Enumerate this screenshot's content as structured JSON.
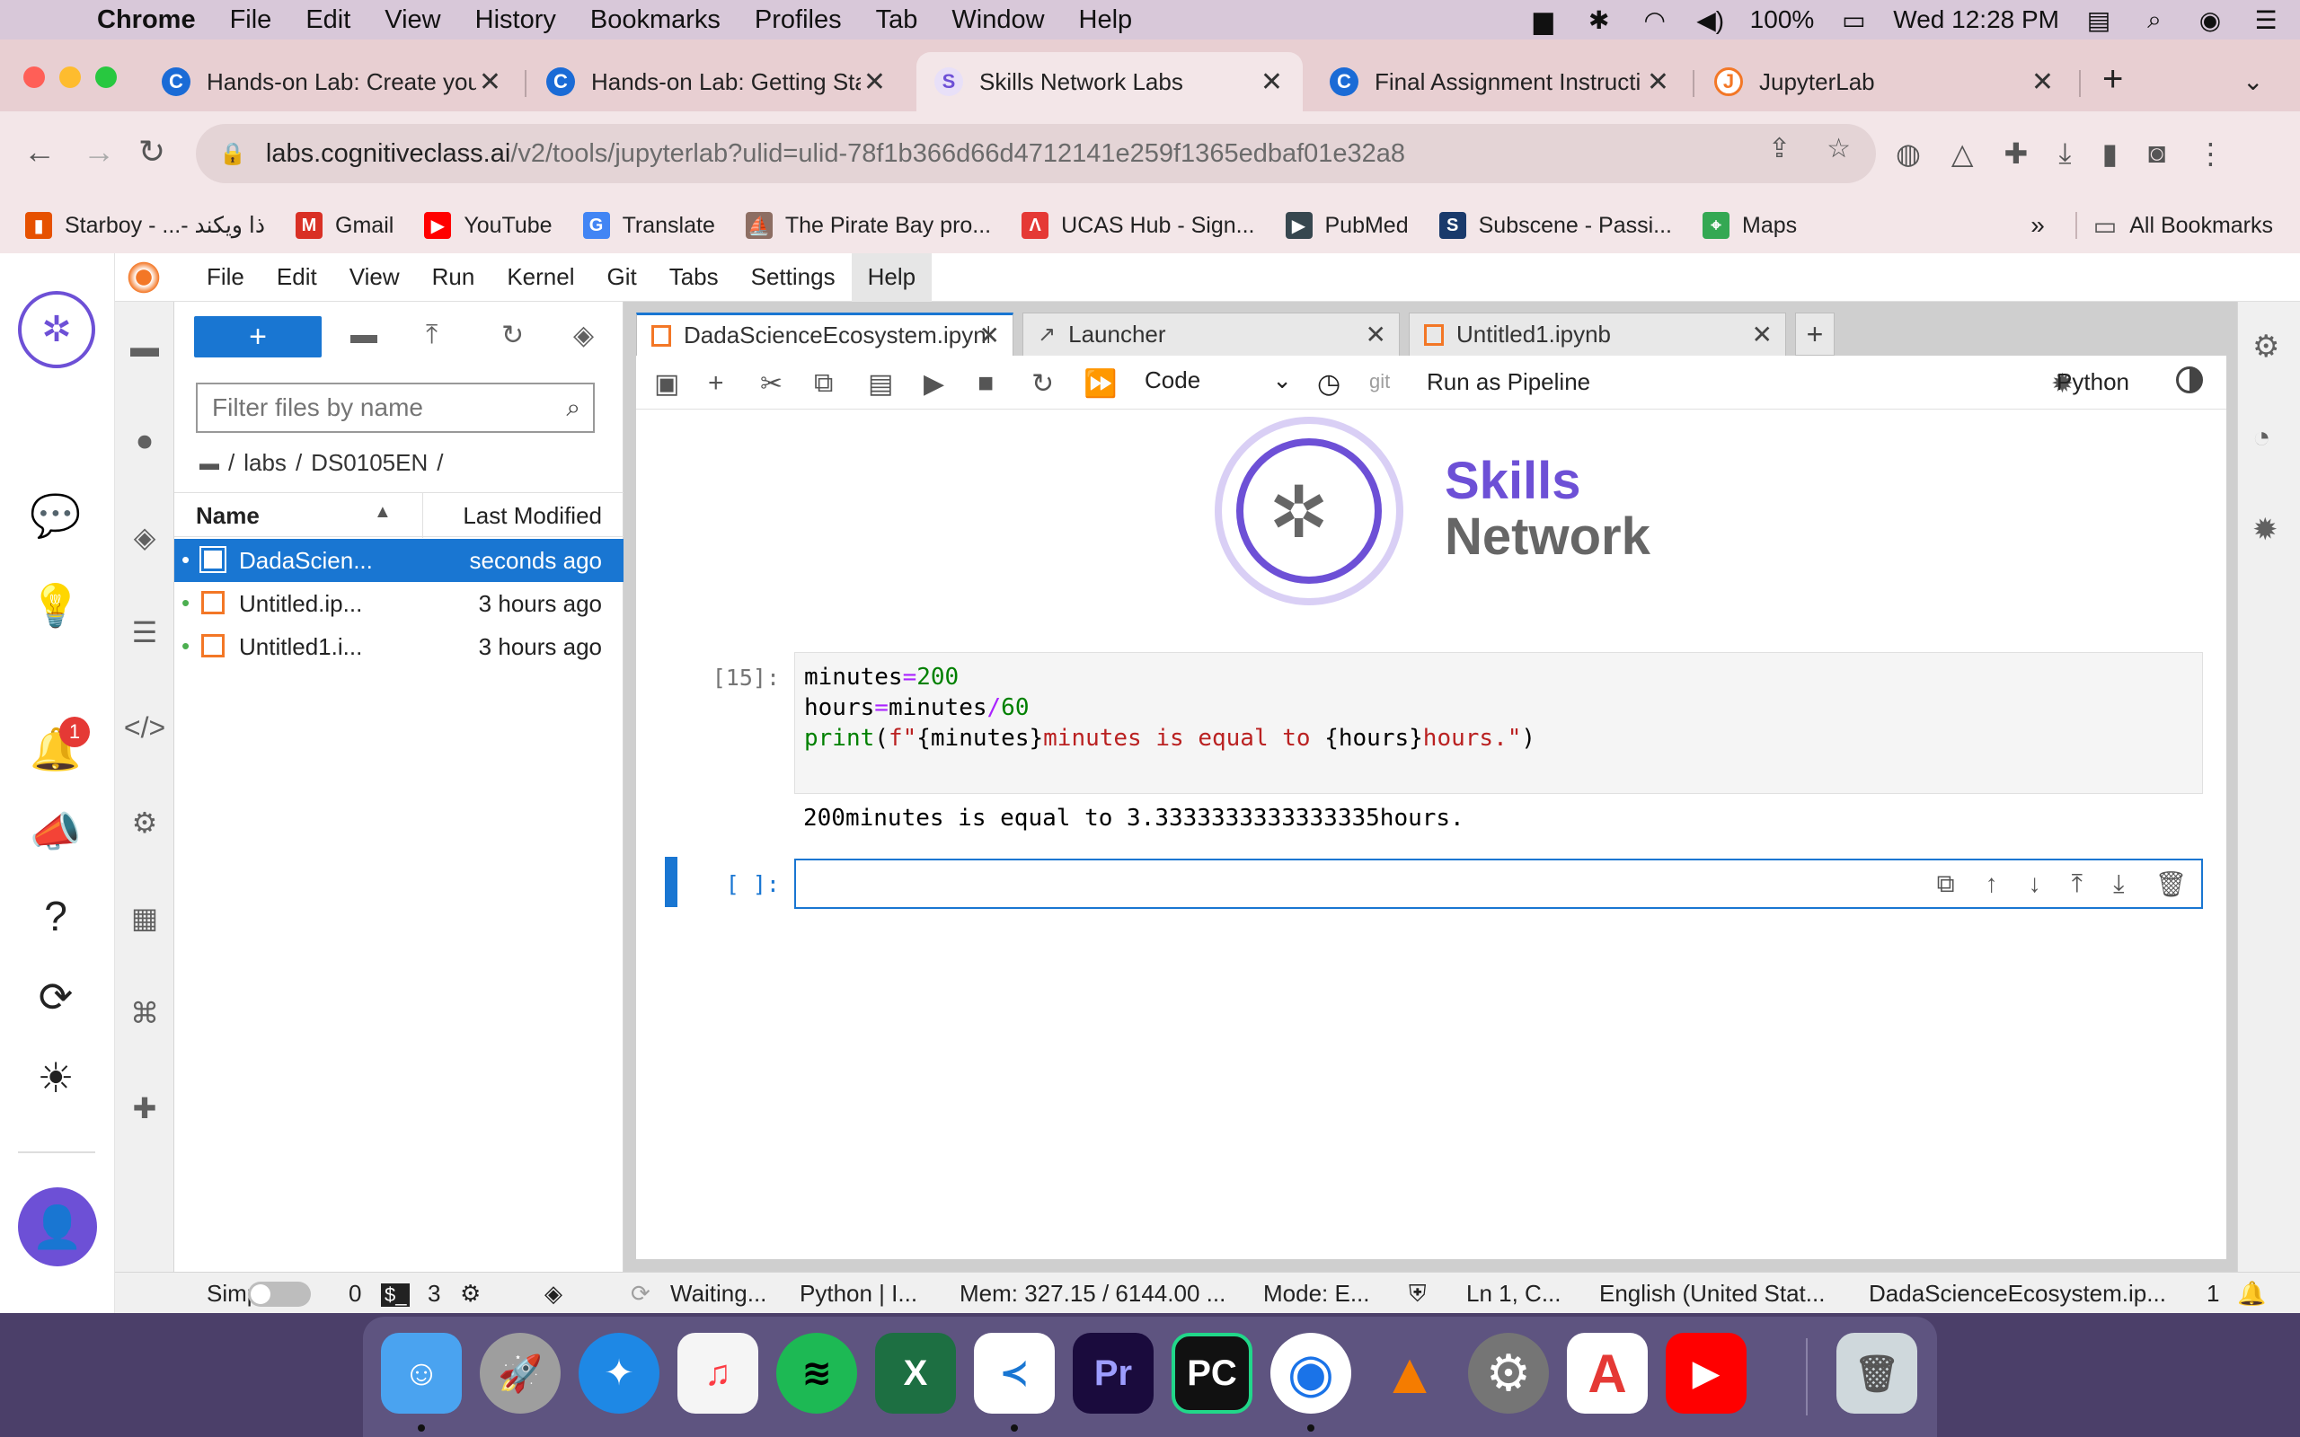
{
  "mac_menubar": {
    "app": "Chrome",
    "items": [
      "File",
      "Edit",
      "View",
      "History",
      "Bookmarks",
      "Profiles",
      "Tab",
      "Window",
      "Help"
    ],
    "battery": "100%",
    "clock": "Wed 12:28 PM"
  },
  "chrome": {
    "tabs": [
      {
        "title": "Hands-on Lab: Create you",
        "favicon": "C"
      },
      {
        "title": "Hands-on Lab: Getting Sta",
        "favicon": "C"
      },
      {
        "title": "Skills Network Labs",
        "favicon": "S"
      },
      {
        "title": "Final Assignment Instructi",
        "favicon": "C"
      },
      {
        "title": "JupyterLab",
        "favicon": "J"
      }
    ],
    "new_tab": "+",
    "url_host": "labs.cognitiveclass.ai",
    "url_path": "/v2/tools/jupyterlab?ulid=ulid-78f1b366d66d4712141e259f1365edbaf01e32a8",
    "bookmarks": [
      {
        "label": "Starboy - ...- ذا ويكند",
        "color": "#e65100",
        "glyph": "▮"
      },
      {
        "label": "Gmail",
        "color": "#d93025",
        "glyph": "M"
      },
      {
        "label": "YouTube",
        "color": "#ff0000",
        "glyph": "▶"
      },
      {
        "label": "Translate",
        "color": "#4285f4",
        "glyph": "G"
      },
      {
        "label": "The Pirate Bay pro...",
        "color": "#8d6e63",
        "glyph": "⛵"
      },
      {
        "label": "UCAS Hub - Sign...",
        "color": "#e53935",
        "glyph": "Λ"
      },
      {
        "label": "PubMed",
        "color": "#37474f",
        "glyph": "▶"
      },
      {
        "label": "Subscene - Passi...",
        "color": "#1a3a6b",
        "glyph": "S"
      },
      {
        "label": "Maps",
        "color": "#34a853",
        "glyph": "⌖"
      }
    ],
    "bookmarks_overflow": "»",
    "all_bookmarks": "All Bookmarks"
  },
  "sn_rail": {
    "notification_count": "1"
  },
  "jupyter": {
    "menu": [
      "File",
      "Edit",
      "View",
      "Run",
      "Kernel",
      "Git",
      "Tabs",
      "Settings",
      "Help"
    ],
    "filebrowser": {
      "new_label": "+",
      "filter_placeholder": "Filter files by name",
      "breadcrumb": [
        "/",
        "labs",
        "/",
        "DS0105EN",
        "/"
      ],
      "col_name": "Name",
      "col_modified": "Last Modified",
      "files": [
        {
          "name": "DadaScien...",
          "modified": "seconds ago"
        },
        {
          "name": "Untitled.ip...",
          "modified": "3 hours ago"
        },
        {
          "name": "Untitled1.i...",
          "modified": "3 hours ago"
        }
      ]
    },
    "doc_tabs": [
      {
        "title": "DadaScienceEcosystem.ipynb"
      },
      {
        "title": "Launcher"
      },
      {
        "title": "Untitled1.ipynb"
      }
    ],
    "toolbar": {
      "cell_type": "Code",
      "git": "git",
      "run_pipeline": "Run as Pipeline",
      "kernel": "Python"
    },
    "logo": {
      "line1": "Skills",
      "line2": "Network"
    },
    "cells": {
      "c1_prompt": "[15]:",
      "c1_line1_a": "minutes",
      "c1_line1_op": "=",
      "c1_line1_num": "200",
      "c1_line2_a": "hours",
      "c1_line2_op": "=",
      "c1_line2_b": "minutes",
      "c1_line2_op2": "/",
      "c1_line2_num": "60",
      "c1_line3_fn": "print",
      "c1_line3_p1": "(",
      "c1_line3_str1": "f\"",
      "c1_line3_var1": "{minutes}",
      "c1_line3_str2": "minutes is equal to ",
      "c1_line3_var2": "{hours}",
      "c1_line3_str3": "hours.\"",
      "c1_line3_p2": ")",
      "c1_output": "200minutes is equal to 3.3333333333333335hours.",
      "c2_prompt": "[ ]:"
    },
    "status": {
      "mode_label": "Simple",
      "count_a": "0",
      "count_b": "3",
      "waiting": "Waiting...",
      "kernel": "Python | I...",
      "mem": "Mem: 327.15 / 6144.00 ...",
      "mode": "Mode: E...",
      "position": "Ln 1, C...",
      "language": "English (United Stat...",
      "file": "DadaScienceEcosystem.ip...",
      "notifications": "1"
    }
  },
  "dock": [
    {
      "name": "finder",
      "color": "#4aa3f0",
      "glyph": "☺"
    },
    {
      "name": "launchpad",
      "color": "#9e9e9e",
      "glyph": "🚀"
    },
    {
      "name": "safari",
      "color": "#1e88e5",
      "glyph": "✦"
    },
    {
      "name": "music",
      "color": "#f5f5f5",
      "glyph": "♫"
    },
    {
      "name": "spotify",
      "color": "#1db954",
      "glyph": "≋"
    },
    {
      "name": "excel",
      "color": "#1d6f42",
      "glyph": "X"
    },
    {
      "name": "vscode",
      "color": "#ffffff",
      "glyph": "≺"
    },
    {
      "name": "premiere",
      "color": "#1a0b3d",
      "glyph": "Pr"
    },
    {
      "name": "pycharm",
      "color": "#111111",
      "glyph": "PC"
    },
    {
      "name": "chrome",
      "color": "#ffffff",
      "glyph": "◉"
    },
    {
      "name": "matlab",
      "color": "#f57c00",
      "glyph": "▲"
    },
    {
      "name": "system-preferences",
      "color": "#757575",
      "glyph": "⚙"
    },
    {
      "name": "autocad",
      "color": "#e53935",
      "glyph": "A"
    },
    {
      "name": "youtube",
      "color": "#ff0000",
      "glyph": "▶"
    },
    {
      "name": "trash",
      "color": "#cfd8dc",
      "glyph": "🗑"
    }
  ]
}
